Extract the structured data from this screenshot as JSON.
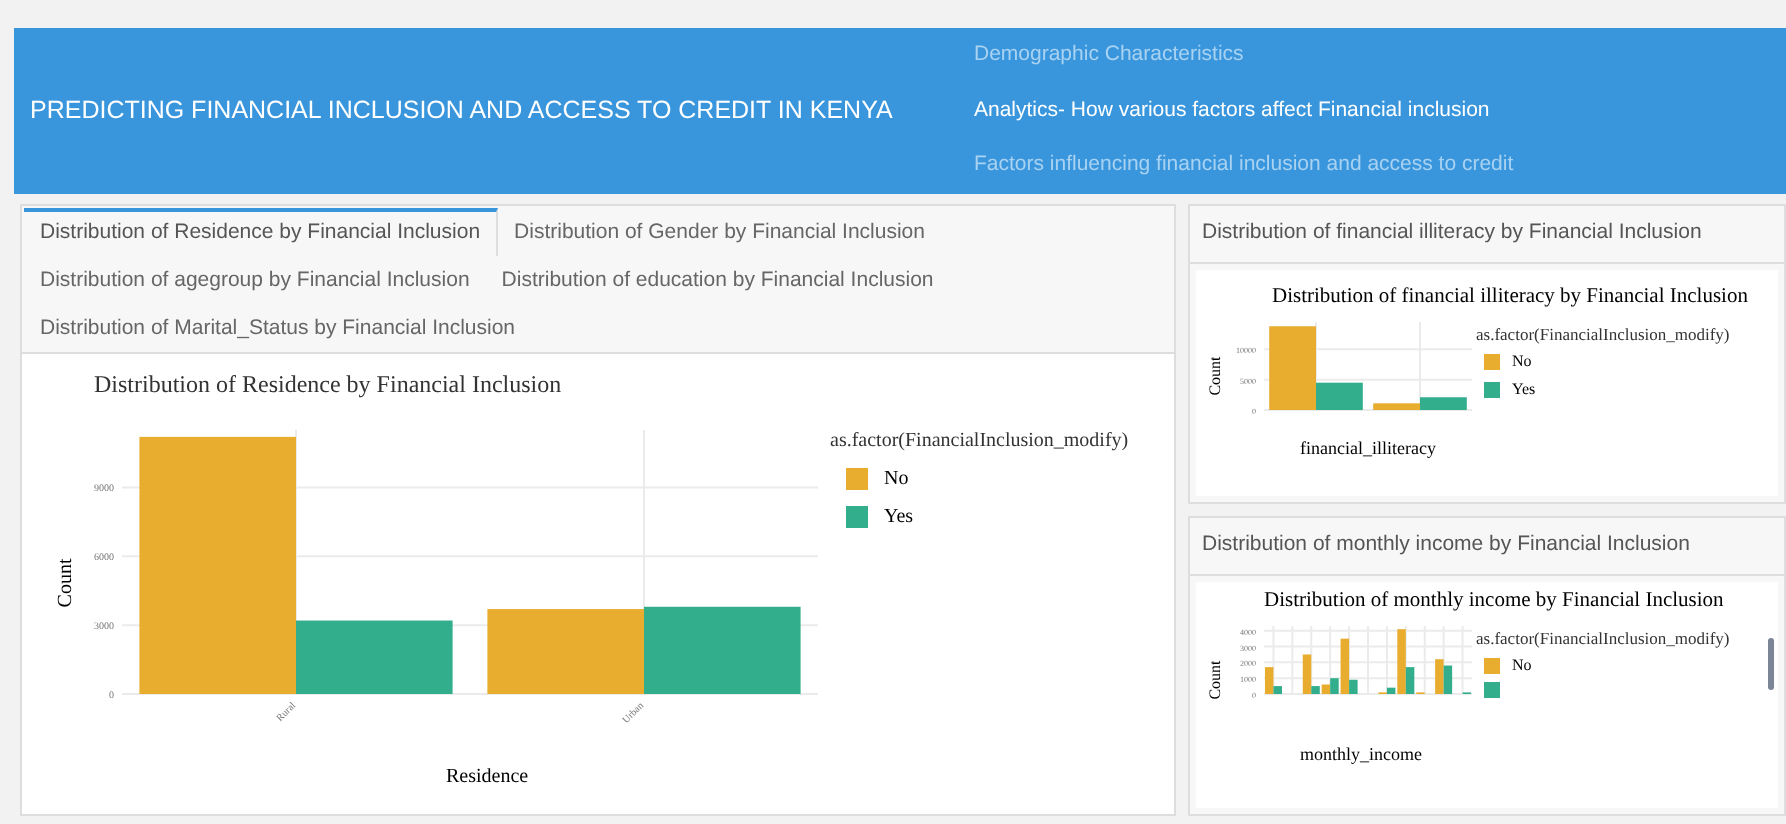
{
  "header": {
    "title": "PREDICTING FINANCIAL INCLUSION AND ACCESS TO CREDIT IN KENYA",
    "nav": [
      {
        "label": "Demographic Characteristics",
        "selected": false
      },
      {
        "label": "Analytics- How various factors affect Financial inclusion",
        "selected": true
      },
      {
        "label": "Factors influencing financial inclusion and access to credit",
        "selected": false
      }
    ]
  },
  "tabs": [
    {
      "label": "Distribution of Residence by Financial Inclusion",
      "selected": true
    },
    {
      "label": "Distribution of Gender by Financial Inclusion",
      "selected": false
    },
    {
      "label": "Distribution of agegroup by Financial Inclusion",
      "selected": false
    },
    {
      "label": "Distribution of education by Financial Inclusion",
      "selected": false
    },
    {
      "label": "Distribution of Marital_Status by Financial Inclusion",
      "selected": false
    }
  ],
  "main_panel": {
    "legend_title": "as.factor(FinancialInclusion_modify)",
    "chart_data": {
      "type": "bar",
      "title": "Distribution of Residence by Financial Inclusion",
      "xlabel": "Residence",
      "ylabel": "Count",
      "categories": [
        "Rural",
        "Urban"
      ],
      "ylim": [
        0,
        11500
      ],
      "yticks": [
        0,
        3000,
        6000,
        9000
      ],
      "series": [
        {
          "name": "No",
          "color": "#e8ad2f",
          "values": [
            11200,
            3700
          ]
        },
        {
          "name": "Yes",
          "color": "#33ae8c",
          "values": [
            3200,
            3800
          ]
        }
      ],
      "grid": true
    }
  },
  "side_panels": [
    {
      "heading": "Distribution of financial illiteracy by Financial Inclusion",
      "legend_title": "as.factor(FinancialInclusion_modify)",
      "chart_data": {
        "type": "bar",
        "grid": true,
        "title": "Distribution of financial illiteracy by Financial Inclusion",
        "xlabel": "financial_illiteracy",
        "ylabel": "Count",
        "ylim": [
          0,
          14500
        ],
        "yticks": [
          0,
          5000,
          10000
        ],
        "series": [
          {
            "name": "No",
            "color": "#e8ad2f",
            "values": [
              13800,
              1100
            ]
          },
          {
            "name": "Yes",
            "color": "#33ae8c",
            "values": [
              4500,
              2100
            ]
          }
        ]
      }
    },
    {
      "heading": "Distribution of monthly income by Financial Inclusion",
      "legend_title": "as.factor(FinancialInclusion_modify)",
      "chart_data": {
        "type": "bar",
        "grid": true,
        "title": "Distribution of monthly income by Financial Inclusion",
        "xlabel": "monthly_income",
        "ylabel": "Count",
        "ylim": [
          0,
          4300
        ],
        "yticks": [
          0,
          1000,
          2000,
          3000,
          4000
        ],
        "series": [
          {
            "name": "No",
            "color": "#e8ad2f",
            "values": [
              1700,
              0,
              2500,
              600,
              3500,
              0,
              100,
              4100,
              100,
              2200,
              0
            ]
          },
          {
            "name": null,
            "color": "#33ae8c",
            "values": [
              500,
              0,
              500,
              1000,
              900,
              0,
              400,
              1700,
              0,
              1800,
              100
            ]
          }
        ]
      }
    }
  ]
}
